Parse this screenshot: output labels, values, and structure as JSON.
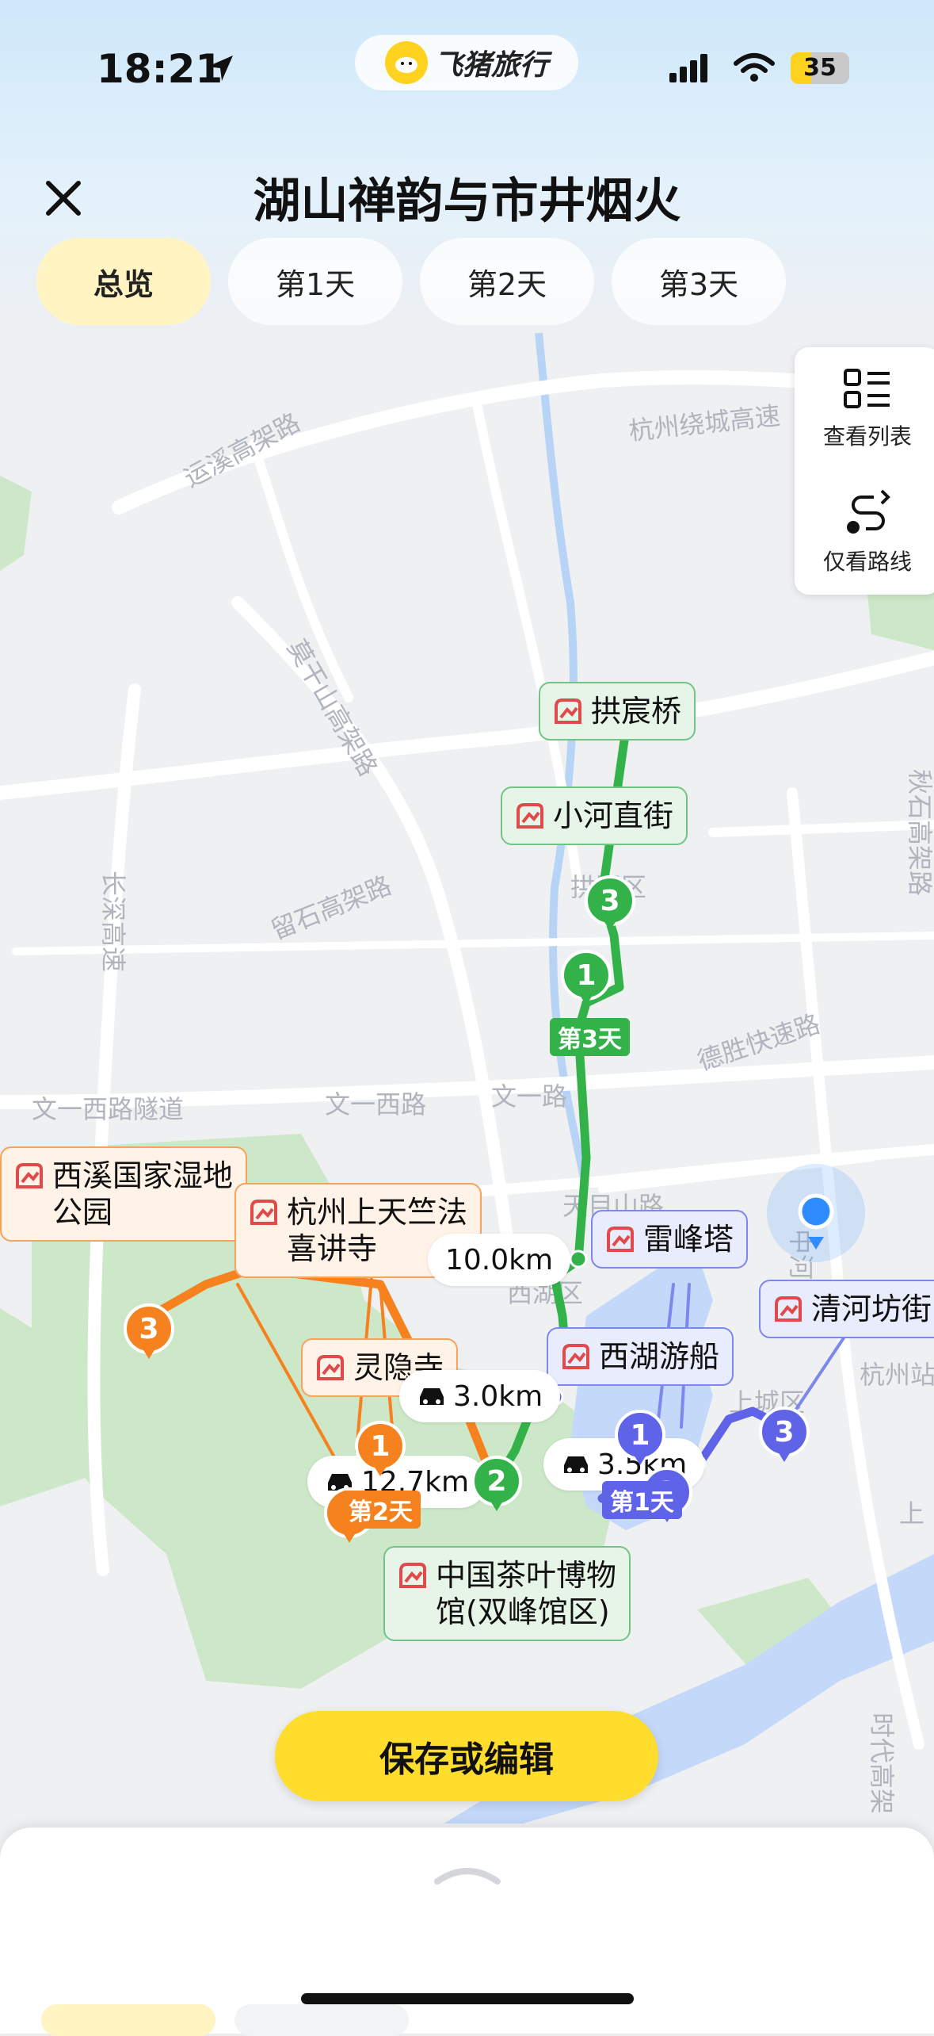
{
  "status_bar": {
    "time": "18:21",
    "battery": "35",
    "battery_level": 0.35
  },
  "brand": {
    "name": "飞猪旅行"
  },
  "header": {
    "title": "湖山禅韵与市井烟火"
  },
  "tabs": [
    {
      "label": "总览",
      "active": true
    },
    {
      "label": "第1天",
      "active": false
    },
    {
      "label": "第2天",
      "active": false
    },
    {
      "label": "第3天",
      "active": false
    }
  ],
  "side_panel": {
    "list_label": "查看列表",
    "route_label": "仅看路线"
  },
  "map_labels": {
    "road1": "运溪高架路",
    "road2": "杭州绕城高速",
    "road3": "莫干山高架路",
    "road4": "留石高架路",
    "road5": "长深高速",
    "road6": "德胜快速路",
    "road7": "文一西路隧道",
    "road8": "文一西路",
    "road9": "文一路",
    "road10": "天目山路",
    "district1": "拱墅区",
    "district2": "西湖区",
    "district3": "上城区",
    "district4": "杭州站",
    "road11": "中河路",
    "road12": "秋石高架路",
    "road13": "时代高架",
    "road14": "上"
  },
  "pois": {
    "gongchenqiao": "拱宸桥",
    "xiaohezhijie": "小河直街",
    "xixi": "西溪国家湿地\n公园",
    "shangtianzhu": "杭州上天竺法\n喜讲寺",
    "leifengta": "雷峰塔",
    "qinghefang": "清河坊街",
    "xihuyouchuan": "西湖游船",
    "lingyinsi": "灵隐寺",
    "chaye": "中国茶叶博物\n馆(双峰馆区)"
  },
  "distances": {
    "d1": "10.0km",
    "d2": "3.0km",
    "d3": "12.7km",
    "d4": "3.5km"
  },
  "day_tags": {
    "day1": "第1天",
    "day2": "第2天",
    "day3": "第3天"
  },
  "markers": {
    "g1": "1",
    "g2": "2",
    "g3": "3",
    "o1": "1",
    "o2": "2",
    "o3": "3",
    "b1": "1",
    "b2": "2",
    "b3": "3"
  },
  "actions": {
    "save": "保存或编辑"
  },
  "colors": {
    "green_route": "#34b24a",
    "orange_route": "#f5821f",
    "blue_route": "#5f63e8",
    "accent_yellow": "#ffdd2d"
  }
}
